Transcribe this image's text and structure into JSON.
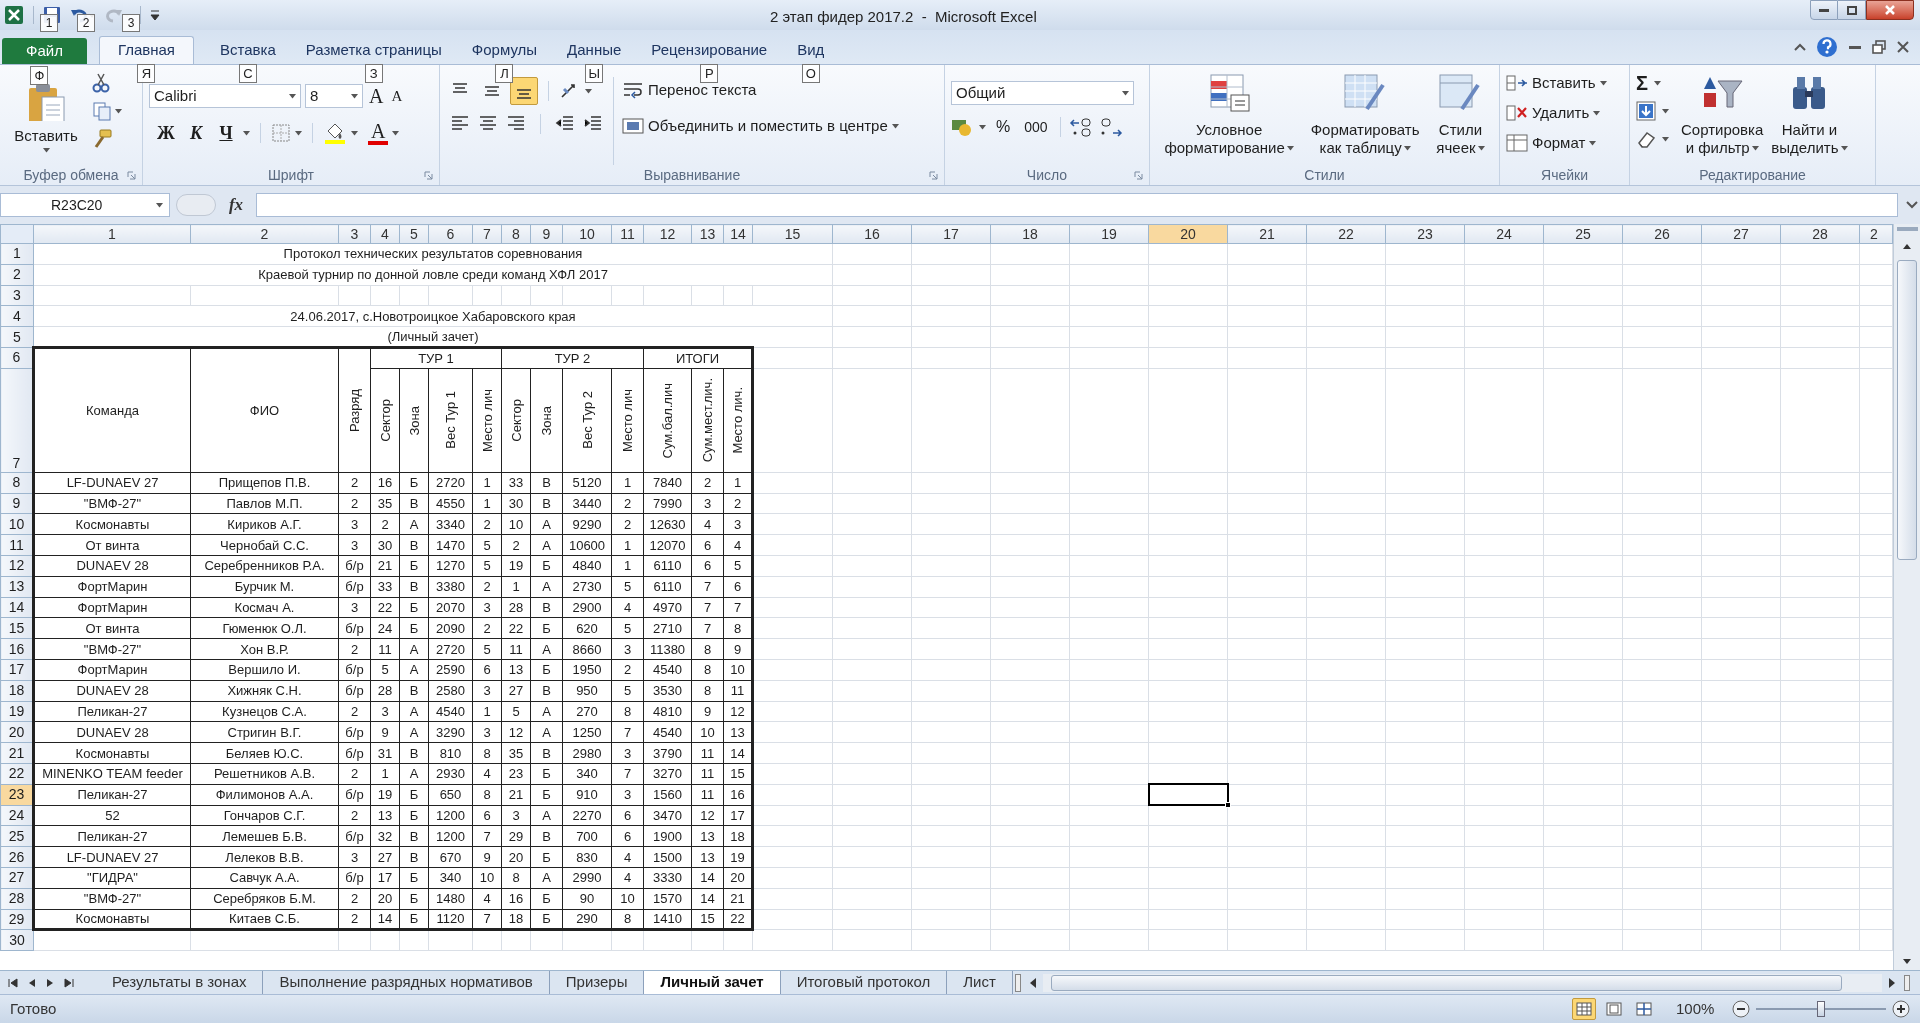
{
  "window": {
    "title": "2 этап фидер 2017.2  -  Microsoft Excel"
  },
  "quick_access_keytips": [
    "1",
    "2",
    "3"
  ],
  "ribbon_tabs": [
    {
      "label": "Файл",
      "keytip": "Ф",
      "kind": "file",
      "selected": false
    },
    {
      "label": "Главная",
      "keytip": "Я",
      "kind": "tab",
      "selected": true
    },
    {
      "label": "Вставка",
      "keytip": "С",
      "kind": "tab",
      "selected": false
    },
    {
      "label": "Разметка страницы",
      "keytip": "З",
      "kind": "tab",
      "selected": false
    },
    {
      "label": "Формулы",
      "keytip": "Л",
      "kind": "tab",
      "selected": false
    },
    {
      "label": "Данные",
      "keytip": "Ы",
      "kind": "tab",
      "selected": false
    },
    {
      "label": "Рецензирование",
      "keytip": "Р",
      "kind": "tab",
      "selected": false
    },
    {
      "label": "Вид",
      "keytip": "О",
      "kind": "tab",
      "selected": false
    }
  ],
  "ribbon": {
    "clipboard": {
      "label": "Буфер обмена",
      "paste": "Вставить"
    },
    "font": {
      "label": "Шрифт",
      "name": "Calibri",
      "size": "8",
      "grow": "A",
      "shrink": "A",
      "bold": "Ж",
      "italic": "К",
      "underline": "Ч",
      "text_color_glyph": "A"
    },
    "alignment": {
      "label": "Выравнивание",
      "vertical": [
        {
          "selected": false
        },
        {
          "selected": false
        },
        {
          "selected": true
        }
      ],
      "wrap": "Перенос текста",
      "merge": "Объединить и поместить в центре"
    },
    "number": {
      "label": "Число",
      "format": "Общий",
      "percent": "%",
      "thousands": "000"
    },
    "styles": {
      "label": "Стили",
      "buttons": [
        {
          "kind": "conditional",
          "lines": [
            "Условное",
            "форматирование"
          ]
        },
        {
          "kind": "table",
          "lines": [
            "Форматировать",
            "как таблицу"
          ]
        },
        {
          "kind": "cell",
          "lines": [
            "Стили",
            "ячеек"
          ]
        }
      ]
    },
    "cells": {
      "label": "Ячейки",
      "buttons": [
        {
          "kind": "insert",
          "label": "Вставить"
        },
        {
          "kind": "delete",
          "label": "Удалить"
        },
        {
          "kind": "format",
          "label": "Формат"
        }
      ]
    },
    "editing": {
      "label": "Редактирование",
      "sum": "Σ",
      "buttons": [
        {
          "kind": "sort",
          "lines": [
            "Сортировка",
            "и фильтр"
          ]
        },
        {
          "kind": "find",
          "lines": [
            "Найти и",
            "выделить"
          ]
        }
      ]
    }
  },
  "formula_bar": {
    "name_box": "R23C20",
    "fx": "fx"
  },
  "sheet": {
    "columns": [
      {
        "label": "1",
        "selected": false
      },
      {
        "label": "2",
        "selected": false
      },
      {
        "label": "3",
        "selected": false
      },
      {
        "label": "4",
        "selected": false
      },
      {
        "label": "5",
        "selected": false
      },
      {
        "label": "6",
        "selected": false
      },
      {
        "label": "7",
        "selected": false
      },
      {
        "label": "8",
        "selected": false
      },
      {
        "label": "9",
        "selected": false
      },
      {
        "label": "10",
        "selected": false
      },
      {
        "label": "11",
        "selected": false
      },
      {
        "label": "12",
        "selected": false
      },
      {
        "label": "13",
        "selected": false
      },
      {
        "label": "14",
        "selected": false
      },
      {
        "label": "15",
        "selected": false
      },
      {
        "label": "16",
        "selected": false
      },
      {
        "label": "17",
        "selected": false
      },
      {
        "label": "18",
        "selected": false
      },
      {
        "label": "19",
        "selected": false
      },
      {
        "label": "20",
        "selected": true
      },
      {
        "label": "21",
        "selected": false
      },
      {
        "label": "22",
        "selected": false
      },
      {
        "label": "23",
        "selected": false
      },
      {
        "label": "24",
        "selected": false
      },
      {
        "label": "25",
        "selected": false
      },
      {
        "label": "26",
        "selected": false
      },
      {
        "label": "27",
        "selected": false
      },
      {
        "label": "28",
        "selected": false
      },
      {
        "label": "2",
        "selected": false
      }
    ],
    "rows": [
      {
        "label": "1",
        "selected": false
      },
      {
        "label": "2",
        "selected": false
      },
      {
        "label": "3",
        "selected": false
      },
      {
        "label": "4",
        "selected": false
      },
      {
        "label": "5",
        "selected": false
      },
      {
        "label": "6",
        "selected": false
      },
      {
        "label": "7",
        "selected": false
      },
      {
        "label": "8",
        "selected": false
      },
      {
        "label": "9",
        "selected": false
      },
      {
        "label": "10",
        "selected": false
      },
      {
        "label": "11",
        "selected": false
      },
      {
        "label": "12",
        "selected": false
      },
      {
        "label": "13",
        "selected": false
      },
      {
        "label": "14",
        "selected": false
      },
      {
        "label": "15",
        "selected": false
      },
      {
        "label": "16",
        "selected": false
      },
      {
        "label": "17",
        "selected": false
      },
      {
        "label": "18",
        "selected": false
      },
      {
        "label": "19",
        "selected": false
      },
      {
        "label": "20",
        "selected": false
      },
      {
        "label": "21",
        "selected": false
      },
      {
        "label": "22",
        "selected": false
      },
      {
        "label": "23",
        "selected": true
      },
      {
        "label": "24",
        "selected": false
      },
      {
        "label": "25",
        "selected": false
      },
      {
        "label": "26",
        "selected": false
      },
      {
        "label": "27",
        "selected": false
      },
      {
        "label": "28",
        "selected": false
      },
      {
        "label": "29",
        "selected": false
      },
      {
        "label": "30",
        "selected": false
      }
    ],
    "title": "Протокол технических результатов соревнования",
    "subtitle": "Краевой турнир по донной ловле среди команд ХФЛ 2017",
    "date_place": "24.06.2017, с.Новотроицкое Хабаровского края",
    "scope": "(Личный зачет)",
    "table": {
      "team": "Команда",
      "name": "ФИО",
      "rank": "Разряд",
      "groups": [
        {
          "label": "ТУР 1",
          "columns": [
            "Сектор",
            "Зона",
            "Вес Тур 1",
            "Место лич"
          ]
        },
        {
          "label": "ТУР 2",
          "columns": [
            "Сектор",
            "Зона",
            "Вес Тур 2",
            "Место лич"
          ]
        },
        {
          "label": "ИТОГИ",
          "columns": [
            "Сум.бал.лич",
            "Сум.мест.лич.",
            "Место лич."
          ]
        }
      ],
      "rows": [
        [
          "LF-DUNAEV 27",
          "Прищепов П.В.",
          "2",
          "16",
          "Б",
          "2720",
          "1",
          "33",
          "В",
          "5120",
          "1",
          "7840",
          "2",
          "1"
        ],
        [
          "\"ВМФ-27\"",
          "Павлов М.П.",
          "2",
          "35",
          "В",
          "4550",
          "1",
          "30",
          "В",
          "3440",
          "2",
          "7990",
          "3",
          "2"
        ],
        [
          "Космонавты",
          "Кириков А.Г.",
          "3",
          "2",
          "А",
          "3340",
          "2",
          "10",
          "А",
          "9290",
          "2",
          "12630",
          "4",
          "3"
        ],
        [
          "От винта",
          "Чернобай С.С.",
          "3",
          "30",
          "В",
          "1470",
          "5",
          "2",
          "А",
          "10600",
          "1",
          "12070",
          "6",
          "4"
        ],
        [
          "DUNAEV 28",
          "Серебренников Р.А.",
          "б/р",
          "21",
          "Б",
          "1270",
          "5",
          "19",
          "Б",
          "4840",
          "1",
          "6110",
          "6",
          "5"
        ],
        [
          "ФортМарин",
          "Бурчик М.",
          "б/р",
          "33",
          "В",
          "3380",
          "2",
          "1",
          "А",
          "2730",
          "5",
          "6110",
          "7",
          "6"
        ],
        [
          "ФортМарин",
          "Космач А.",
          "3",
          "22",
          "Б",
          "2070",
          "3",
          "28",
          "В",
          "2900",
          "4",
          "4970",
          "7",
          "7"
        ],
        [
          "От винта",
          "Гюменюк О.Л.",
          "б/р",
          "24",
          "Б",
          "2090",
          "2",
          "22",
          "Б",
          "620",
          "5",
          "2710",
          "7",
          "8"
        ],
        [
          "\"ВМФ-27\"",
          "Хон В.Р.",
          "2",
          "11",
          "А",
          "2720",
          "5",
          "11",
          "А",
          "8660",
          "3",
          "11380",
          "8",
          "9"
        ],
        [
          "ФортМарин",
          "Вершило И.",
          "б/р",
          "5",
          "А",
          "2590",
          "6",
          "13",
          "Б",
          "1950",
          "2",
          "4540",
          "8",
          "10"
        ],
        [
          "DUNAEV 28",
          "Хижняк С.Н.",
          "б/р",
          "28",
          "В",
          "2580",
          "3",
          "27",
          "В",
          "950",
          "5",
          "3530",
          "8",
          "11"
        ],
        [
          "Пеликан-27",
          "Кузнецов С.А.",
          "2",
          "3",
          "А",
          "4540",
          "1",
          "5",
          "А",
          "270",
          "8",
          "4810",
          "9",
          "12"
        ],
        [
          "DUNAEV 28",
          "Стригин В.Г.",
          "б/р",
          "9",
          "А",
          "3290",
          "3",
          "12",
          "А",
          "1250",
          "7",
          "4540",
          "10",
          "13"
        ],
        [
          "Космонавты",
          "Беляев Ю.С.",
          "б/р",
          "31",
          "В",
          "810",
          "8",
          "35",
          "В",
          "2980",
          "3",
          "3790",
          "11",
          "14"
        ],
        [
          "MINENKO TEAM feeder",
          "Решетников А.В.",
          "2",
          "1",
          "А",
          "2930",
          "4",
          "23",
          "Б",
          "340",
          "7",
          "3270",
          "11",
          "15"
        ],
        [
          "Пеликан-27",
          "Филимонов А.А.",
          "б/р",
          "19",
          "Б",
          "650",
          "8",
          "21",
          "Б",
          "910",
          "3",
          "1560",
          "11",
          "16"
        ],
        [
          "52",
          "Гончаров С.Г.",
          "2",
          "13",
          "Б",
          "1200",
          "6",
          "3",
          "А",
          "2270",
          "6",
          "3470",
          "12",
          "17"
        ],
        [
          "Пеликан-27",
          "Лемешев Б.В.",
          "б/р",
          "32",
          "В",
          "1200",
          "7",
          "29",
          "В",
          "700",
          "6",
          "1900",
          "13",
          "18"
        ],
        [
          "LF-DUNAEV 27",
          "Лелеков В.В.",
          "3",
          "27",
          "В",
          "670",
          "9",
          "20",
          "Б",
          "830",
          "4",
          "1500",
          "13",
          "19"
        ],
        [
          "\"ГИДРА\"",
          "Савчук А.А.",
          "б/р",
          "17",
          "Б",
          "340",
          "10",
          "8",
          "А",
          "2990",
          "4",
          "3330",
          "14",
          "20"
        ],
        [
          "\"ВМФ-27\"",
          "Серебряков Б.М.",
          "2",
          "20",
          "Б",
          "1480",
          "4",
          "16",
          "Б",
          "90",
          "10",
          "1570",
          "14",
          "21"
        ],
        [
          "Космонавты",
          "Китаев С.Б.",
          "2",
          "14",
          "Б",
          "1120",
          "7",
          "18",
          "Б",
          "290",
          "8",
          "1410",
          "15",
          "22"
        ]
      ]
    }
  },
  "sheet_tabs": [
    {
      "label": "Результаты в зонах",
      "selected": false
    },
    {
      "label": "Выполнение разрядных нормативов",
      "selected": false
    },
    {
      "label": "Призеры",
      "selected": false
    },
    {
      "label": "Личный зачет",
      "selected": true
    },
    {
      "label": "Итоговый протокол",
      "selected": false
    },
    {
      "label": "Лист",
      "selected": false
    }
  ],
  "status_bar": {
    "status": "Готово",
    "views": [
      {
        "selected": true
      },
      {
        "selected": false
      },
      {
        "selected": false
      }
    ],
    "zoom": "100%",
    "zoom_level": {
      "level": 0.5
    }
  }
}
